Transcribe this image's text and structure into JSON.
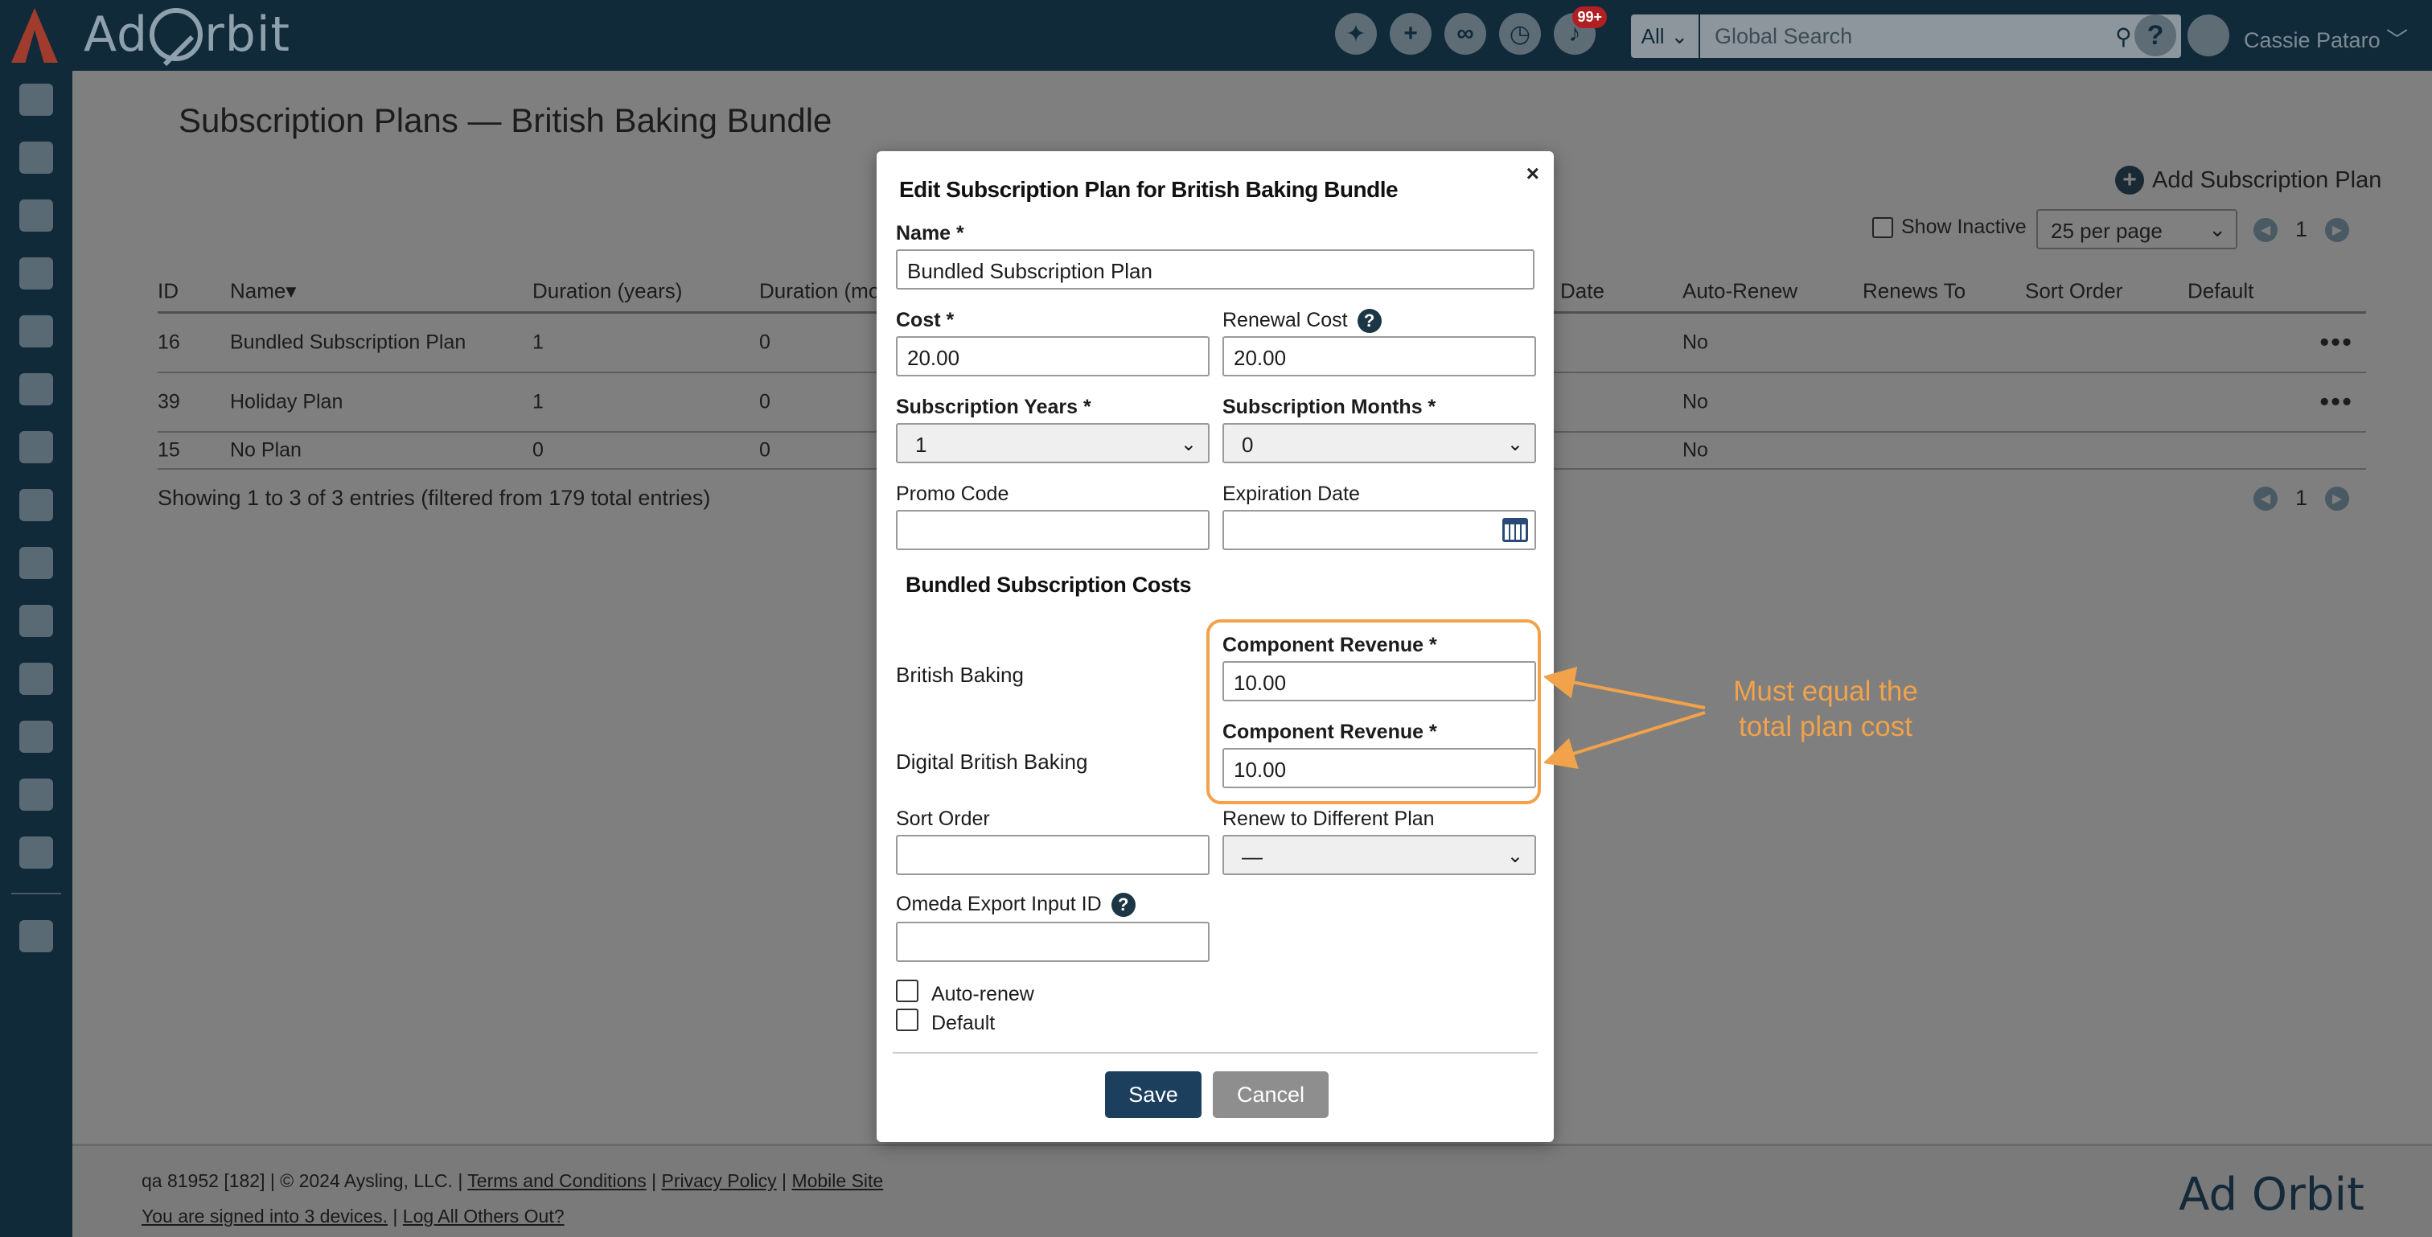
{
  "app": {
    "brand": "Ad Orbit",
    "notifications_badge": "99+",
    "search_scope": "All",
    "search_placeholder": "Global Search",
    "user_name": "Cassie Pataro"
  },
  "page": {
    "title": "Subscription Plans — British Baking Bundle",
    "add_button": "Add Subscription Plan",
    "show_inactive": "Show Inactive",
    "per_page": "25 per page",
    "page_number": "1"
  },
  "table": {
    "columns": [
      "ID",
      "Name",
      "Duration (years)",
      "Duration (mo",
      "Date",
      "Auto-Renew",
      "Renews To",
      "Sort Order",
      "Default"
    ],
    "rows": [
      {
        "id": "16",
        "name": "Bundled Subscription Plan",
        "years": "1",
        "months": "0",
        "auto_renew": "No"
      },
      {
        "id": "39",
        "name": "Holiday Plan",
        "years": "1",
        "months": "0",
        "auto_renew": "No"
      },
      {
        "id": "15",
        "name": "No Plan",
        "years": "0",
        "months": "0",
        "auto_renew": "No"
      }
    ],
    "showing": "Showing 1 to 3 of 3 entries (filtered from 179 total entries)"
  },
  "modal": {
    "title": "Edit Subscription Plan for British Baking Bundle",
    "close": "×",
    "name_label": "Name *",
    "name_value": "Bundled Subscription Plan",
    "cost_label": "Cost *",
    "cost_value": "20.00",
    "renewal_label": "Renewal Cost",
    "renewal_value": "20.00",
    "years_label": "Subscription Years *",
    "years_value": "1",
    "months_label": "Subscription Months *",
    "months_value": "0",
    "promo_label": "Promo Code",
    "expiration_label": "Expiration Date",
    "bundle_heading": "Bundled Subscription Costs",
    "components": [
      {
        "name": "British Baking",
        "label": "Component Revenue *",
        "value": "10.00"
      },
      {
        "name": "Digital British Baking",
        "label": "Component Revenue *",
        "value": "10.00"
      }
    ],
    "sort_label": "Sort Order",
    "renew_label": "Renew to Different Plan",
    "renew_value": "—",
    "omeda_label": "Omeda Export Input ID",
    "auto_renew_label": "Auto-renew",
    "default_label": "Default",
    "save": "Save",
    "cancel": "Cancel"
  },
  "annotation": {
    "line1": "Must equal the",
    "line2": "total plan cost",
    "color": "#f1a24a"
  },
  "footer": {
    "line1_prefix": "qa 81952 [182] | © 2024 Aysling, LLC. | ",
    "terms": "Terms and Conditions",
    "privacy": "Privacy Policy",
    "mobile": "Mobile Site",
    "signed_in": "You are signed into 3 devices.",
    "log_out": "Log All Others Out?",
    "brand": "Ad Orbit"
  }
}
